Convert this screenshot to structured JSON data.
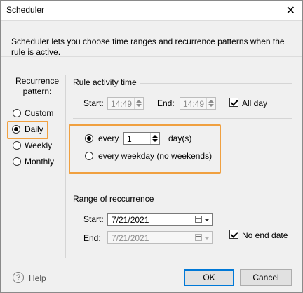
{
  "window": {
    "title": "Scheduler",
    "close_glyph": "✕"
  },
  "description": "Scheduler lets you choose time ranges and recurrence patterns when the rule is active.",
  "recurrence": {
    "label": "Recurrence pattern:",
    "options": [
      {
        "label": "Custom",
        "selected": false
      },
      {
        "label": "Daily",
        "selected": true
      },
      {
        "label": "Weekly",
        "selected": false
      },
      {
        "label": "Monthly",
        "selected": false
      }
    ]
  },
  "rule_activity": {
    "heading": "Rule activity time",
    "start_label": "Start:",
    "start_value": "14:49",
    "end_label": "End:",
    "end_value": "14:49",
    "all_day_label": "All day",
    "all_day_checked": true
  },
  "daily": {
    "every_label": "every",
    "every_value": "1",
    "unit": "day(s)",
    "weekday_label": "every weekday (no weekends)",
    "every_selected": true
  },
  "range": {
    "heading": "Range of reccurrence",
    "start_label": "Start:",
    "start_value": "7/21/2021",
    "end_label": "End:",
    "end_value": "7/21/2021",
    "no_end_label": "No end date",
    "no_end_checked": true
  },
  "footer": {
    "help_label": "Help",
    "ok_label": "OK",
    "cancel_label": "Cancel"
  },
  "colors": {
    "highlight": "#f0a040",
    "accent": "#0078d7"
  }
}
